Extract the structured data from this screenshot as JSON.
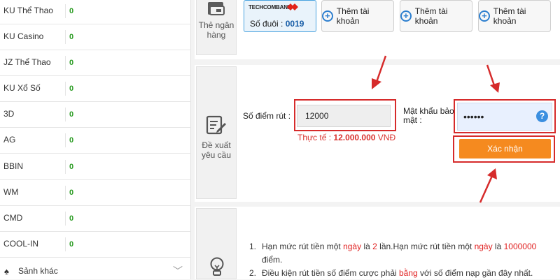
{
  "sidebar": {
    "items": [
      {
        "name": "KU Thể Thao",
        "value": "0"
      },
      {
        "name": "KU Casino",
        "value": "0"
      },
      {
        "name": "JZ Thể Thao",
        "value": "0"
      },
      {
        "name": "KU Xổ Số",
        "value": "0"
      },
      {
        "name": "3D",
        "value": "0"
      },
      {
        "name": "AG",
        "value": "0"
      },
      {
        "name": "BBIN",
        "value": "0"
      },
      {
        "name": "WM",
        "value": "0"
      },
      {
        "name": "CMD",
        "value": "0"
      },
      {
        "name": "COOL-IN",
        "value": "0"
      }
    ],
    "more_icon": "♠",
    "more_label": "Sảnh khác",
    "chevron": "﹀"
  },
  "bank_section": {
    "label_line1": "Thẻ ngân",
    "label_line2": "hàng",
    "card": {
      "bank_logo": "TECHCOMBANK",
      "account_prefix": "Số đuôi :",
      "account_suffix": "0019"
    },
    "add_buttons": [
      "Thêm tài khoản",
      "Thêm tài khoản",
      "Thêm tài khoản"
    ]
  },
  "withdraw_section": {
    "label_line1": "Đề xuất",
    "label_line2": "yêu cầu",
    "points_label": "Số điểm rút :",
    "points_value": "12000",
    "actual_prefix": "Thực tế :",
    "actual_value": "12.000.000",
    "actual_unit": "VNĐ",
    "password_label_line1": "Mật khẩu bảo",
    "password_label_line2": "mật :",
    "password_value": "••••••",
    "help_icon": "?",
    "confirm_label": "Xác nhận"
  },
  "notes": {
    "item1": {
      "num": "1.",
      "t1": "Hạn mức rút tiền một ",
      "h1": "ngày",
      "t2": " là ",
      "h2": "2",
      "t3": " lần.Hạn mức rút tiền một ",
      "h3": "ngày",
      "t4": " là ",
      "h4": "1000000",
      "t5": "điểm."
    },
    "item2": {
      "num": "2.",
      "t1": "Điều kiện rút tiền số điểm cược phải ",
      "h1": "bằng",
      "t2": " với số điểm nạp gần đây nhất."
    }
  },
  "colors": {
    "accent_orange": "#f58a1f",
    "annotation_red": "#d62b2b",
    "value_green": "#2f9e27",
    "link_blue": "#2d7fcf"
  }
}
